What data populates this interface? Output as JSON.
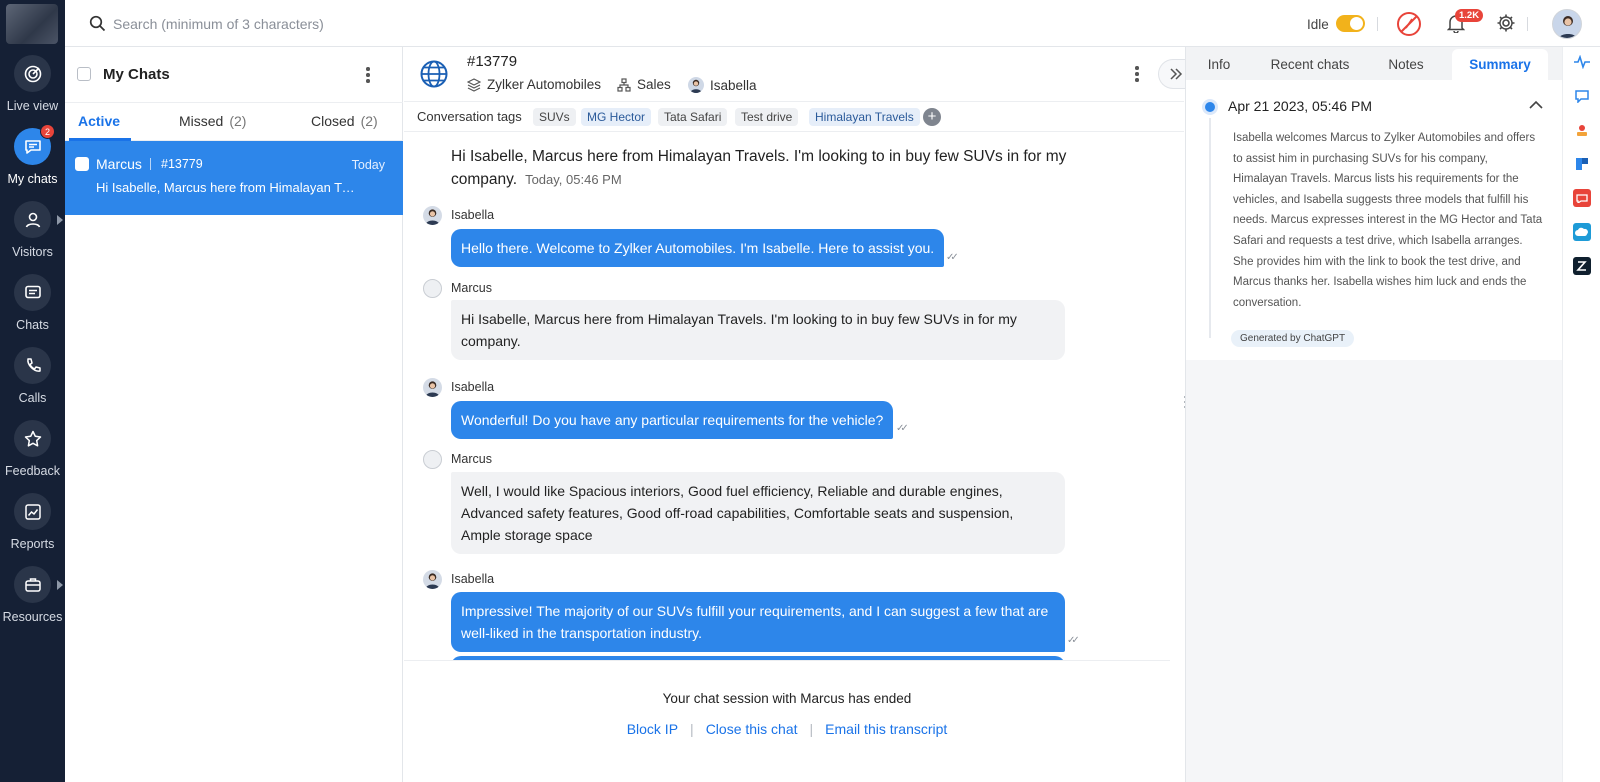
{
  "rail": {
    "items": [
      {
        "label": "Live view",
        "icon": "live-view-icon"
      },
      {
        "label": "My chats",
        "icon": "chat-bubble-icon",
        "badge": "2"
      },
      {
        "label": "Visitors",
        "icon": "visitor-icon"
      },
      {
        "label": "Chats",
        "icon": "chats-icon"
      },
      {
        "label": "Calls",
        "icon": "phone-icon"
      },
      {
        "label": "Feedback",
        "icon": "star-icon"
      },
      {
        "label": "Reports",
        "icon": "chart-icon"
      },
      {
        "label": "Resources",
        "icon": "briefcase-icon"
      }
    ]
  },
  "topbar": {
    "search_placeholder": "Search (minimum of 3 characters)",
    "status": "Idle",
    "notification_count": "1.2K"
  },
  "chat_list": {
    "title": "My Chats",
    "tabs": [
      {
        "label": "Active",
        "count": ""
      },
      {
        "label": "Missed",
        "count": "(2)"
      },
      {
        "label": "Closed",
        "count": "(2)"
      }
    ],
    "items": [
      {
        "name": "Marcus",
        "id": "#13779",
        "time": "Today",
        "preview": "Hi Isabelle, Marcus here from Himalayan Travels. I'm looking to in buy few SUVs in for my company."
      }
    ]
  },
  "conversation": {
    "id": "#13779",
    "brand": "Zylker Automobiles",
    "department": "Sales",
    "agent": "Isabella",
    "tags_label": "Conversation tags",
    "tags": [
      "SUVs",
      "MG Hector",
      "Tata Safari",
      "Test drive",
      "Himalayan Travels"
    ],
    "first_message": "Hi Isabelle, Marcus here from Himalayan Travels. I'm looking to in buy few SUVs in for my company.",
    "first_message_time": "Today, 05:46 PM",
    "messages": [
      {
        "sender": "Isabella",
        "text": "Hello there. Welcome to Zylker Automobiles. I'm Isabelle. Here to assist you."
      },
      {
        "sender": "Marcus",
        "text": "Hi Isabelle, Marcus here from Himalayan Travels. I'm looking to in buy few SUVs in for my company."
      },
      {
        "sender": "Isabella",
        "text": "Wonderful! Do you have any particular requirements for the vehicle?"
      },
      {
        "sender": "Marcus",
        "text": "Well, I would like Spacious interiors, Good fuel efficiency, Reliable and durable engines, Advanced safety features, Good off-road capabilities, Comfortable seats and suspension, Ample storage space"
      },
      {
        "sender": "Isabella",
        "text": "Impressive! The majority of our SUVs fulfill your requirements, and I can suggest a few that are well-liked in the transportation industry."
      }
    ],
    "ended_text": "Your chat session with Marcus has ended",
    "actions": {
      "block": "Block IP",
      "close": "Close this chat",
      "email": "Email this transcript"
    }
  },
  "side_panel": {
    "tabs": [
      "Info",
      "Recent chats",
      "Notes",
      "Summary"
    ],
    "summary": {
      "date": "Apr 21 2023, 05:46 PM",
      "text": "Isabella welcomes Marcus to Zylker Automobiles and offers to assist him in purchasing SUVs for his company, Himalayan Travels. Marcus lists his requirements for the vehicles, and Isabella suggests three models that fulfill his needs. Marcus expresses interest in the MG Hector and Tata Safari and requests a test drive, which Isabella arranges. She provides him with the link to book the test drive, and Marcus thanks her. Isabella wishes him luck and ends the conversation.",
      "badge": "Generated by ChatGPT"
    }
  },
  "integrations": [
    "activity-icon",
    "chat-widget-icon",
    "desk-icon",
    "planner-icon",
    "ticket-icon",
    "salesforce-icon",
    "zendesk-icon"
  ],
  "colors": {
    "accent": "#2d86ea",
    "rail": "#152035",
    "idle": "#f2b21b",
    "badge": "#e8443a"
  }
}
